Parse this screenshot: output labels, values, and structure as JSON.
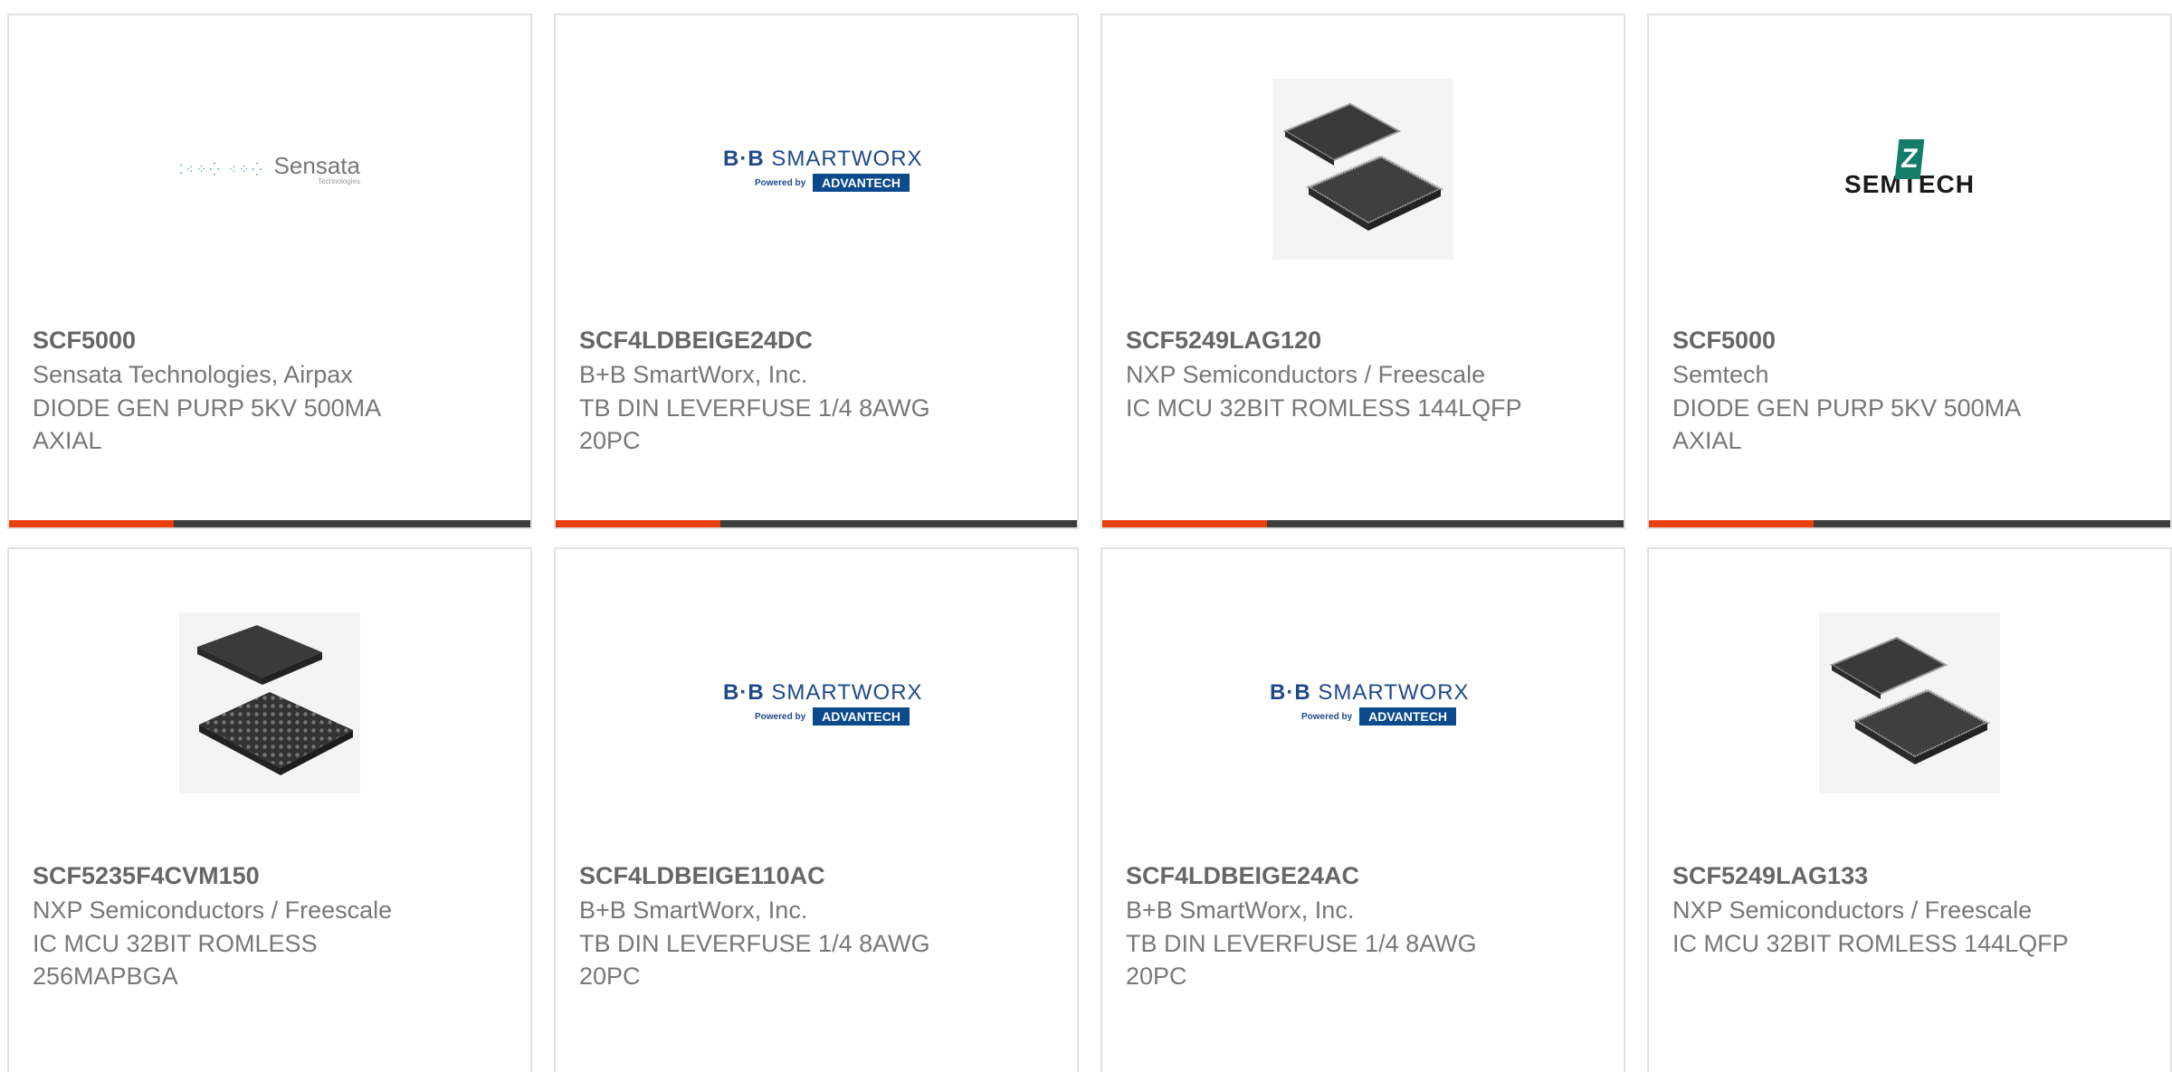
{
  "colors": {
    "accent": "#e8400c",
    "bar_dark": "#3d3d3d",
    "border": "#e2e2e2"
  },
  "cards": [
    {
      "part_number": "SCF5000",
      "manufacturer": "Sensata Technologies, Airpax",
      "description": "DIODE GEN PURP 5KV 500MA AXIAL",
      "image": "sensata-logo",
      "logo_text": "Sensata",
      "logo_subtext": "Technologies"
    },
    {
      "part_number": "SCF4LDBEIGE24DC",
      "manufacturer": "B+B SmartWorx, Inc.",
      "description": "TB DIN LEVERFUSE 1/4 8AWG 20PC",
      "image": "bb-smartworx-logo",
      "logo_text": "B+B SmartWorx",
      "logo_powered": "Powered by",
      "logo_brand": "ADVANTECH"
    },
    {
      "part_number": "SCF5249LAG120",
      "manufacturer": "NXP Semiconductors / Freescale",
      "description": "IC MCU 32BIT ROMLESS 144LQFP",
      "image": "lqfp-chip-photo"
    },
    {
      "part_number": "SCF5000",
      "manufacturer": "Semtech",
      "description": "DIODE GEN PURP 5KV 500MA AXIAL",
      "image": "semtech-logo",
      "logo_text": "SEMTECH"
    },
    {
      "part_number": "SCF5235F4CVM150",
      "manufacturer": "NXP Semiconductors / Freescale",
      "description": "IC MCU 32BIT ROMLESS 256MAPBGA",
      "image": "bga-chip-photo"
    },
    {
      "part_number": "SCF4LDBEIGE110AC",
      "manufacturer": "B+B SmartWorx, Inc.",
      "description": "TB DIN LEVERFUSE 1/4 8AWG 20PC",
      "image": "bb-smartworx-logo",
      "logo_text": "B+B SmartWorx",
      "logo_powered": "Powered by",
      "logo_brand": "ADVANTECH"
    },
    {
      "part_number": "SCF4LDBEIGE24AC",
      "manufacturer": "B+B SmartWorx, Inc.",
      "description": "TB DIN LEVERFUSE 1/4 8AWG 20PC",
      "image": "bb-smartworx-logo",
      "logo_text": "B+B SmartWorx",
      "logo_powered": "Powered by",
      "logo_brand": "ADVANTECH"
    },
    {
      "part_number": "SCF5249LAG133",
      "manufacturer": "NXP Semiconductors / Freescale",
      "description": "IC MCU 32BIT ROMLESS 144LQFP",
      "image": "lqfp-chip-photo"
    }
  ]
}
